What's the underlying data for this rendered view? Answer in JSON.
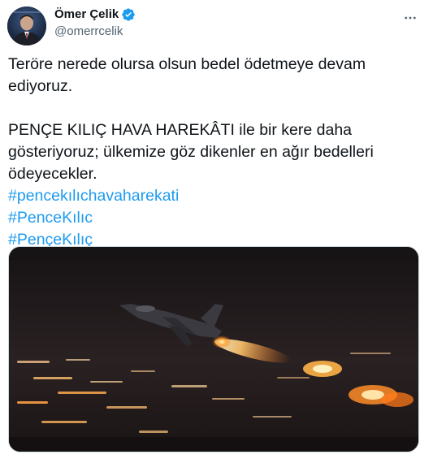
{
  "author": {
    "display_name": "Ömer Çelik",
    "handle": "@omerrcelik",
    "verified": true,
    "avatar_icon": "profile-photo",
    "verified_icon": "verified-badge-icon"
  },
  "tweet": {
    "line1": "Teröre nerede olursa olsun bedel ödetmeye devam ediyoruz.",
    "line2": "PENÇE KILIÇ HAVA HAREKÂTI ile bir kere daha gösteriyoruz; ülkemize göz dikenler en ağır bedelleri ödeyecekler.",
    "hashtags": [
      "#pencekılıchavaharekati",
      "#PenceKılıc",
      "#PençeKılıç"
    ]
  },
  "more_icon": "more-horizontal-icon",
  "media": {
    "type": "photo",
    "subject": "fighter-jet-night-takeoff-image"
  },
  "colors": {
    "accent": "#1d9bf0",
    "text": "#0f1419",
    "secondary": "#536471"
  }
}
